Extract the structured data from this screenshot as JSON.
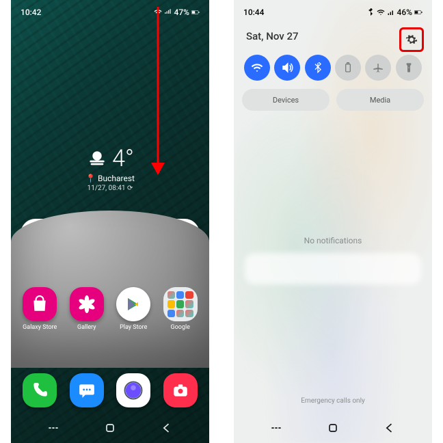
{
  "left": {
    "status": {
      "time": "10:42",
      "battery": "47%"
    },
    "weather": {
      "temp": "4°",
      "location": "Bucharest",
      "datetime": "11/27, 08:41"
    },
    "apps": [
      {
        "name": "Galaxy Store",
        "color": "#e6007e",
        "glyph": "shopping-bag"
      },
      {
        "name": "Gallery",
        "color": "#e6007e",
        "glyph": "flower"
      },
      {
        "name": "Play Store",
        "color": "#ffffff",
        "glyph": "play-triangle"
      },
      {
        "name": "Google",
        "color": "folder",
        "glyph": "folder"
      }
    ],
    "dock": [
      {
        "name": "Phone",
        "color": "#1fbf3f",
        "glyph": "phone"
      },
      {
        "name": "Messages",
        "color": "#1a8cff",
        "glyph": "message"
      },
      {
        "name": "Internet",
        "color": "#6b4eff",
        "glyph": "globe"
      },
      {
        "name": "Camera",
        "color": "#ff2e4d",
        "glyph": "camera"
      }
    ]
  },
  "right": {
    "status": {
      "time": "10:44",
      "battery": "46%"
    },
    "date": "Sat, Nov 27",
    "toggles": [
      {
        "name": "wifi",
        "on": true
      },
      {
        "name": "sound",
        "on": true
      },
      {
        "name": "bluetooth",
        "on": true
      },
      {
        "name": "battery",
        "on": false
      },
      {
        "name": "airplane",
        "on": false
      },
      {
        "name": "flashlight",
        "on": false
      }
    ],
    "pills": {
      "devices": "Devices",
      "media": "Media"
    },
    "no_notifications": "No notifications",
    "emergency": "Emergency calls only"
  }
}
